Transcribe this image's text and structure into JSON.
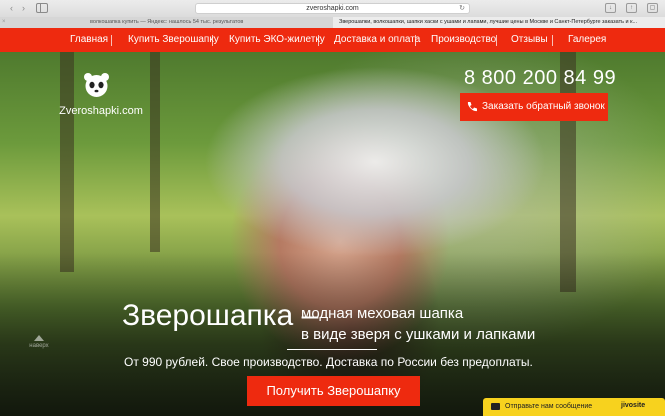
{
  "browser": {
    "url": "zveroshapki.com",
    "tabs": [
      "волкошапка купить — Яндекс: нашлось 54 тыс. результатов",
      "Зверошапки, волкошапки, шапки хаски с ушами и лапами, лучшие цены в Москве и Санкт-Петербурге заказать и к..."
    ]
  },
  "nav": {
    "items": [
      "Главная",
      "Купить Зверошапку",
      "Купить ЭКО-жилетку",
      "Доставка и оплата",
      "Производство",
      "Отзывы",
      "Галерея"
    ]
  },
  "header": {
    "logo_text": "Zveroshapki.com",
    "phone": "8 800 200 84 99",
    "callback_label": "Заказать обратный звонок"
  },
  "hero": {
    "title": "Зверошапка –",
    "subtitle_line1": "модная меховая шапка",
    "subtitle_line2": "в виде зверя с ушками и лапками",
    "tagline": "От 990 рублей. Свое производство. Доставка по России без предоплаты.",
    "cta_label": "Получить Зверошапку",
    "up_label": "наверх"
  },
  "chat": {
    "label": "Отправьте нам сообщение",
    "brand": "jivosite"
  },
  "colors": {
    "accent": "#ee2a0f",
    "chat": "#f7d21e"
  }
}
